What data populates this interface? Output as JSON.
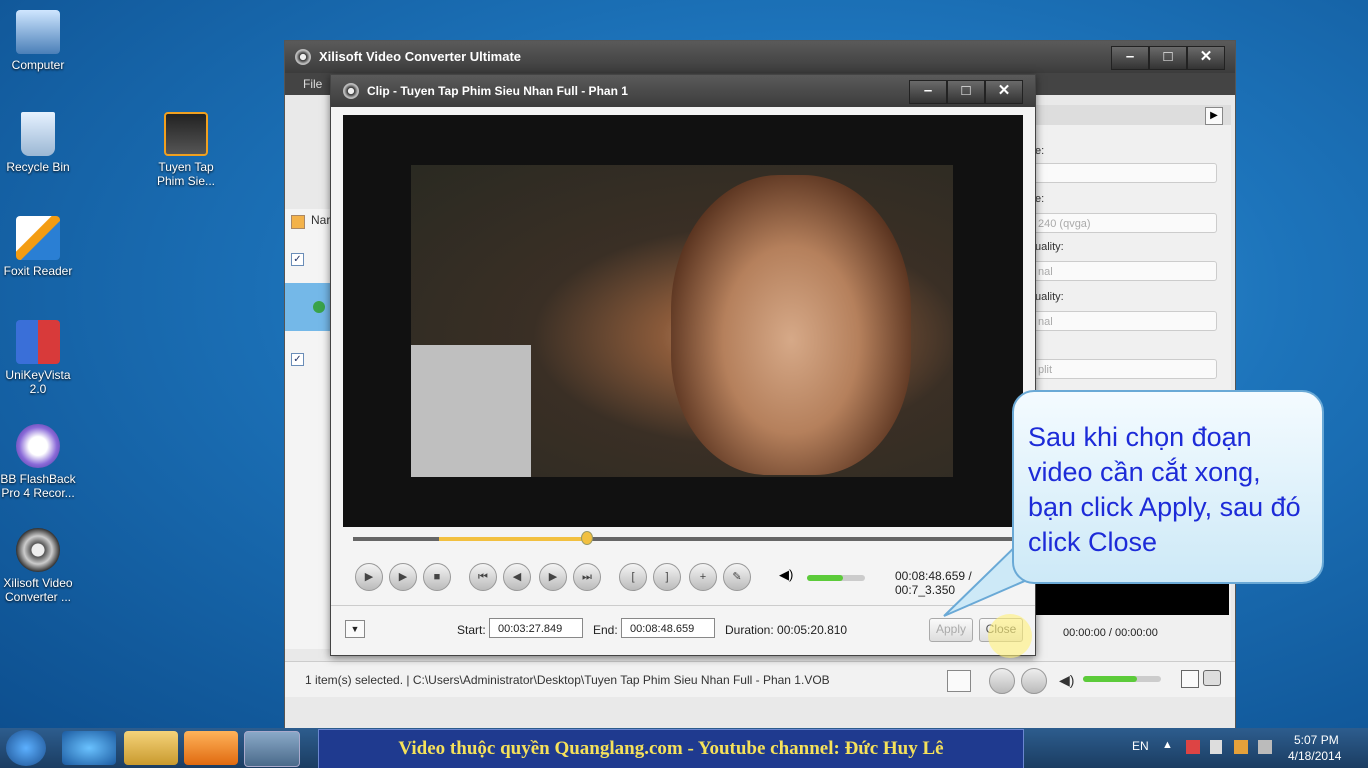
{
  "desktop": {
    "icons": [
      {
        "label": "Computer"
      },
      {
        "label": "Recycle Bin"
      },
      {
        "label": "Tuyen Tap Phim Sie..."
      },
      {
        "label": "Foxit Reader"
      },
      {
        "label": "UniKeyVista 2.0"
      },
      {
        "label": "BB FlashBack Pro 4 Recor..."
      },
      {
        "label": "Xilisoft Video Converter ..."
      }
    ]
  },
  "main_window": {
    "title": "Xilisoft Video Converter Ultimate",
    "menu_file": "File",
    "list_header": "Nar",
    "right_panel": {
      "labels": [
        "e:",
        "e:",
        "uality:",
        "uality:"
      ],
      "fields": [
        "",
        "240 (qvga)",
        "nal",
        "nal",
        "plit"
      ]
    },
    "preview_time": "00:00:00 / 00:00:00",
    "status_text": "1 item(s) selected. | C:\\Users\\Administrator\\Desktop\\Tuyen Tap Phim Sieu Nhan Full - Phan 1.VOB"
  },
  "clip_dialog": {
    "title": "Clip - Tuyen Tap Phim Sieu Nhan Full - Phan 1",
    "time_display": "00:08:48.659 / 00:7_3.350",
    "volume_level": 0.62,
    "start_label": "Start:",
    "start_value": "00:03:27.849",
    "end_label": "End:",
    "end_value": "00:08:48.659",
    "duration_text": "Duration: 00:05:20.810",
    "apply_label": "Apply",
    "close_label": "Close"
  },
  "callout": {
    "text": "Sau khi chọn đoạn video cần cắt xong, bạn click Apply, sau đó click Close"
  },
  "taskbar": {
    "banner": "Video thuộc quyền Quanglang.com - Youtube channel: Đức Huy Lê",
    "language": "EN",
    "time": "5:07 PM",
    "date": "4/18/2014"
  }
}
